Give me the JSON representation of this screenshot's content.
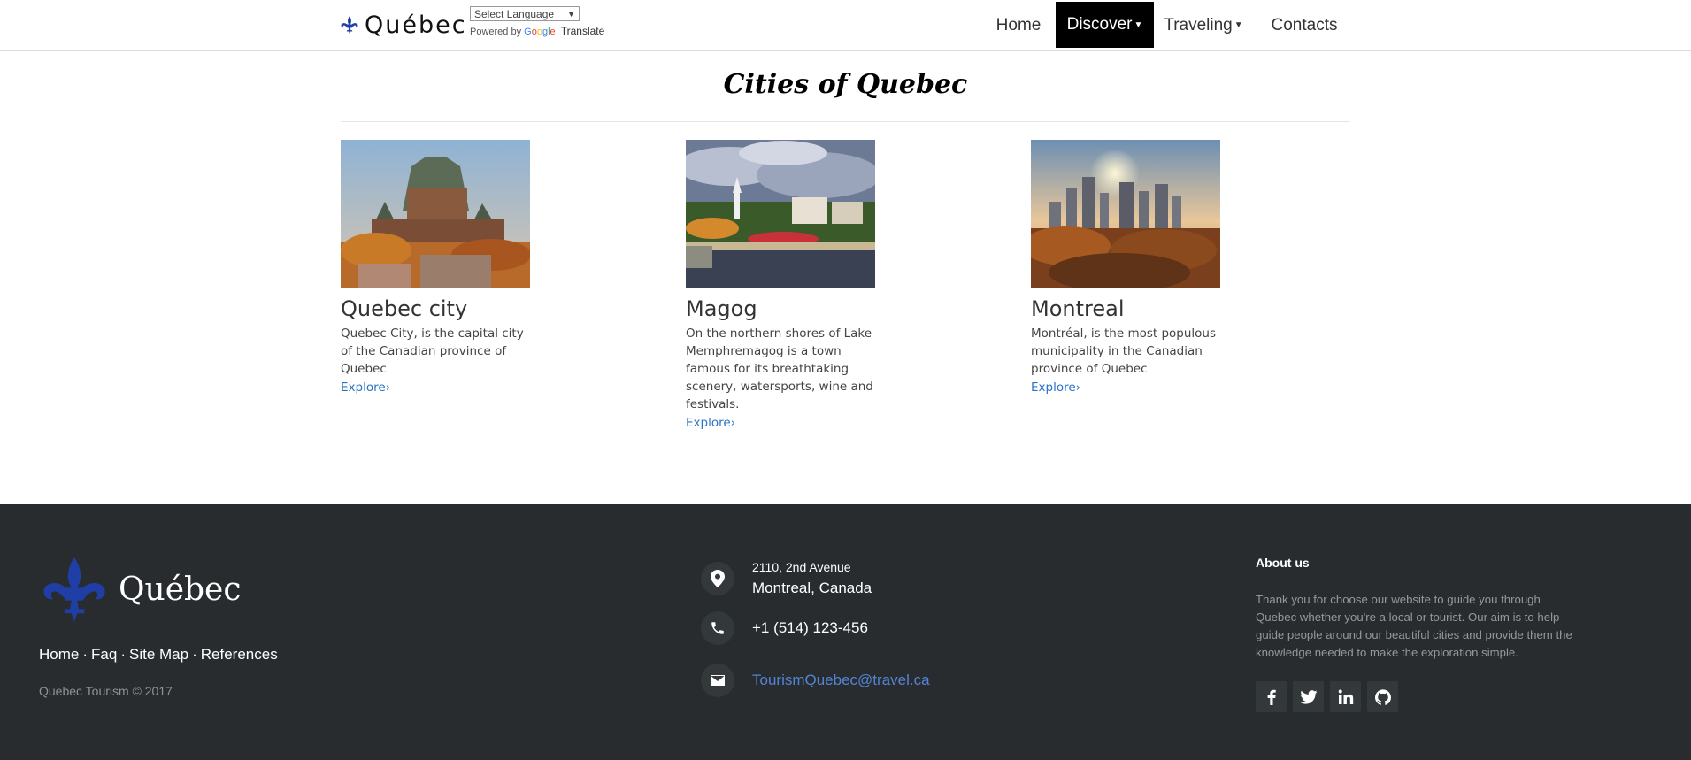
{
  "header": {
    "brand": "Québec",
    "translate": {
      "select_value": "Select Language",
      "powered_by": "Powered by",
      "google": "Google",
      "translate": "Translate"
    },
    "nav": [
      {
        "label": "Home",
        "active": false
      },
      {
        "label": "Discover",
        "active": true,
        "dropdown": true
      },
      {
        "label": "Traveling",
        "active": false,
        "dropdown": true
      },
      {
        "label": "Contacts",
        "active": false
      }
    ]
  },
  "main": {
    "title": "Cities of Quebec",
    "cities": [
      {
        "name": "Quebec city",
        "description": "Quebec City, is the capital city of the Canadian province of Quebec",
        "link": "Explore›"
      },
      {
        "name": "Magog",
        "description": "On the northern shores of Lake Memphremagog is a town famous for its breathtaking scenery, watersports, wine and festivals.",
        "link": "Explore›"
      },
      {
        "name": "Montreal",
        "description": "Montréal, is the most populous municipality in the Canadian province of Quebec",
        "link": "Explore›"
      }
    ]
  },
  "footer": {
    "brand": "Québec",
    "links": [
      "Home",
      "Faq",
      "Site Map",
      "References"
    ],
    "separator": "·",
    "copyright": "Quebec Tourism © 2017",
    "address_line1": "2110, 2nd Avenue",
    "address_line2": "Montreal, Canada",
    "phone": "+1 (514) 123-456",
    "email": "TourismQuebec@travel.ca",
    "about_title": "About us",
    "about_text": "Thank you for choose our website to guide you through Quebec whether you're a local or tourist. Our aim is to help guide people around our beautiful cities and provide them the knowledge needed to make the exploration simple.",
    "socials": [
      {
        "icon": "facebook-icon",
        "glyph": "f"
      },
      {
        "icon": "twitter-icon",
        "glyph": "t"
      },
      {
        "icon": "linkedin-icon",
        "glyph": "in"
      },
      {
        "icon": "github-icon",
        "glyph": "gh"
      }
    ]
  },
  "colors": {
    "accent_link": "#2a74c4",
    "footer_bg": "#292c2f",
    "fleur_blue": "#1f3fa6",
    "email_link": "#5383d3"
  }
}
